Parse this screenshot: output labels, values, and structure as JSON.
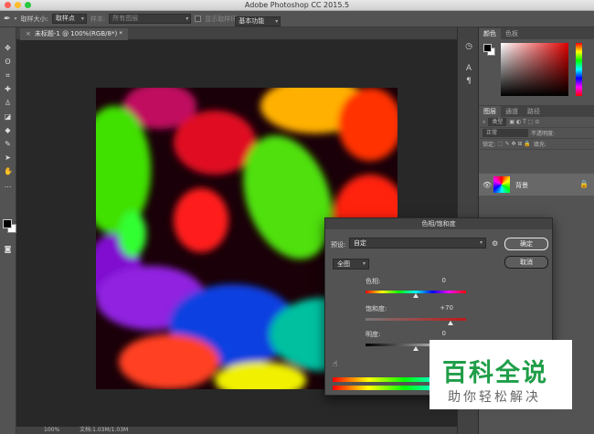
{
  "window": {
    "title": "Adobe Photoshop CC 2015.5"
  },
  "options_bar": {
    "sample_size_label": "取样大小:",
    "sample_size_value": "取样点",
    "sample_label": "样本:",
    "sample_value": "所有图层",
    "show_ring_label": "显示取样环",
    "workspace_value": "基本功能"
  },
  "document_tab": {
    "close": "×",
    "title": "未标题-1 @ 100%(RGB/8*) *"
  },
  "status_bar": {
    "zoom": "100%",
    "doc_size": "文档:1.03M/1.03M"
  },
  "color_panel": {
    "tabs": [
      "颜色",
      "色板"
    ]
  },
  "layers_panel": {
    "tabs": [
      "图层",
      "通道",
      "路径"
    ],
    "filter_value": "类型",
    "blend_mode": "正常",
    "opacity_label": "不透明度:",
    "lock_label": "锁定:",
    "fill_label": "填充:",
    "layer_name": "背景"
  },
  "dialog": {
    "title": "色相/饱和度",
    "preset_label": "预设:",
    "preset_value": "自定",
    "ok_label": "确定",
    "cancel_label": "取消",
    "channel_value": "全图",
    "hue_label": "色相:",
    "hue_value": "0",
    "saturation_label": "饱和度:",
    "saturation_value": "+70",
    "lightness_label": "明度:",
    "lightness_value": "0"
  },
  "watermark": {
    "main": "百科全说",
    "sub": "助你轻松解决"
  },
  "colors": {
    "panel": "#535353",
    "dark": "#424242",
    "accent_green": "#1f9e48"
  }
}
